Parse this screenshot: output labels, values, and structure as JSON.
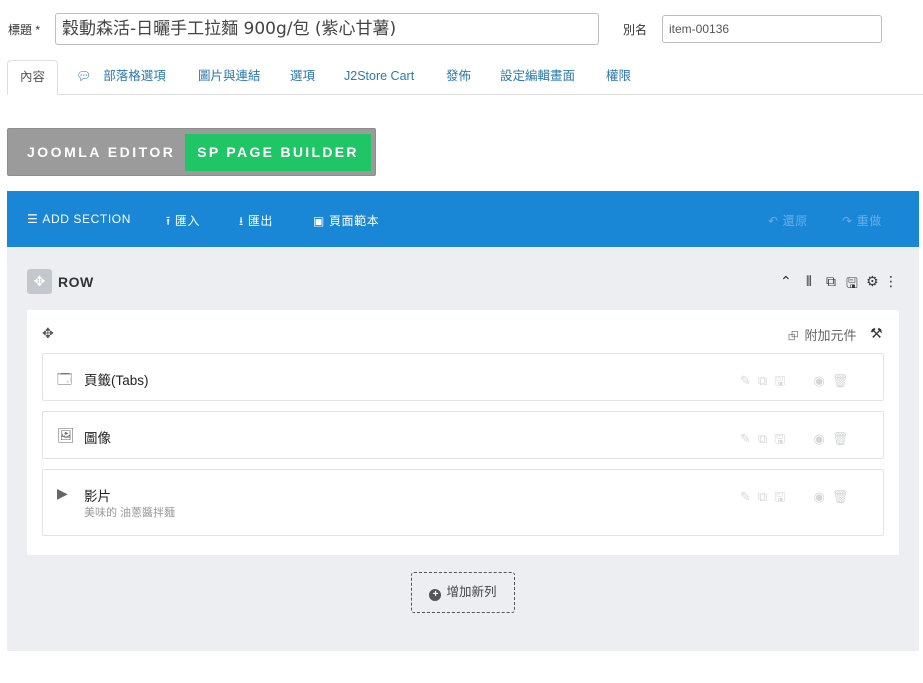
{
  "form": {
    "title_label": "標題 *",
    "title_value": "穀動森活-日曬手工拉麵 900g/包 (紫心甘薯)",
    "alias_label": "別名",
    "alias_value": "item-00136"
  },
  "tabs": [
    {
      "label": "內容",
      "active": true
    },
    {
      "label": "部落格選項",
      "icon": "comment-icon"
    },
    {
      "label": "圖片與連結"
    },
    {
      "label": "選項"
    },
    {
      "label": "J2Store Cart"
    },
    {
      "label": "發佈"
    },
    {
      "label": "設定編輯畫面"
    },
    {
      "label": "權限"
    }
  ],
  "editor_switch": {
    "joomla_label": "JOOMLA EDITOR",
    "sppb_label": "SP PAGE BUILDER"
  },
  "toolbar": {
    "add_section": "ADD SECTION",
    "import": "匯入",
    "export": "匯出",
    "templates": "頁面範本",
    "undo": "還原",
    "redo": "重做"
  },
  "row": {
    "title": "ROW",
    "add_addon": "附加元件",
    "addons": [
      {
        "name": "頁籤(Tabs)",
        "icon": "tabs-icon"
      },
      {
        "name": "圖像",
        "icon": "image-icon"
      },
      {
        "name": "影片",
        "icon": "video-icon",
        "description": "美味的 油蔥醬拌麵"
      }
    ]
  },
  "add_row_label": "增加新列",
  "colors": {
    "toolbar": "#1a86d6",
    "sppb_active": "#20c565",
    "switch_bg": "#9b9b9b",
    "canvas": "#eceef2",
    "link": "#2a7ab0"
  }
}
